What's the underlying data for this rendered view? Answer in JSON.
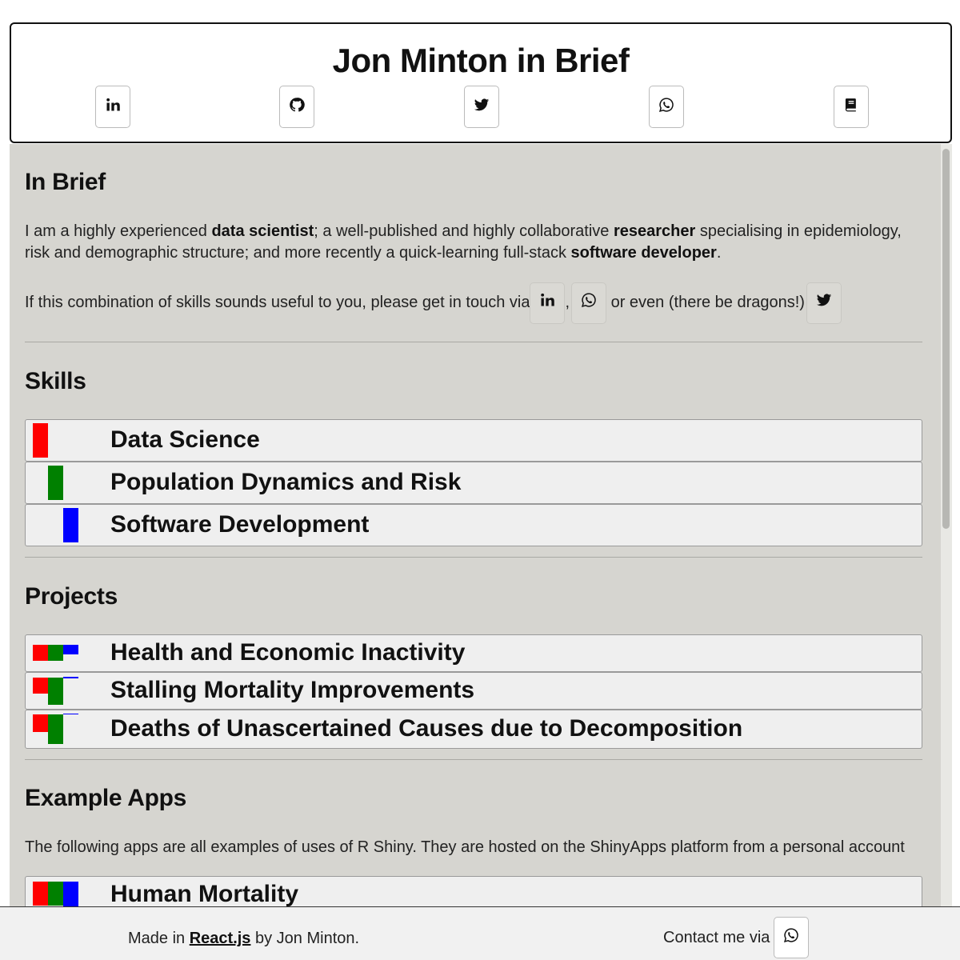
{
  "header": {
    "title": "Jon Minton in Brief",
    "icons": [
      "linkedin-icon",
      "github-icon",
      "twitter-icon",
      "whatsapp-icon",
      "book-icon"
    ]
  },
  "in_brief": {
    "heading": "In Brief",
    "para1": {
      "t1": "I am a highly experienced ",
      "b1": "data scientist",
      "t2": "; a well-published and highly collaborative ",
      "b2": "researcher",
      "t3": " specialising in epidemiology, risk and demographic structure; and more recently a quick-learning full-stack ",
      "b3": "software developer",
      "t4": "."
    },
    "para2": {
      "t1": "If this combination of skills sounds useful to you, please get in touch via",
      "sep": ",",
      "t2": "or even (there be dragons!)"
    }
  },
  "skills": {
    "heading": "Skills",
    "items": [
      {
        "label": "Data Science"
      },
      {
        "label": "Population Dynamics and Risk"
      },
      {
        "label": "Software Development"
      }
    ]
  },
  "projects": {
    "heading": "Projects",
    "items": [
      {
        "label": "Health and Economic Inactivity"
      },
      {
        "label": "Stalling Mortality Improvements"
      },
      {
        "label": "Deaths of Unascertained Causes due to Decomposition"
      }
    ]
  },
  "example_apps": {
    "heading": "Example Apps",
    "description": "The following apps are all examples of uses of R Shiny. They are hosted on the ShinyApps platform from a personal account",
    "items": [
      {
        "label": "Human Mortality"
      }
    ]
  },
  "footer": {
    "made_in": "Made in",
    "link": "React.js",
    "by": "by Jon Minton.",
    "contact": "Contact me via"
  },
  "colors": {
    "red": "#ff0000",
    "green": "#008000",
    "blue": "#0000ff",
    "panel_bg": "#d6d5d0",
    "card_bg": "#efefef"
  }
}
